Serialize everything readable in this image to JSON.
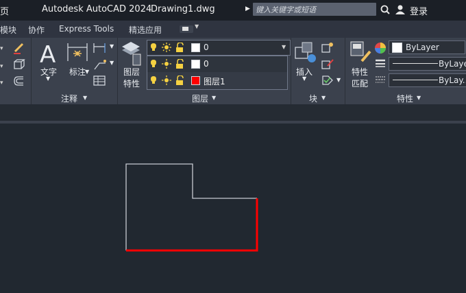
{
  "titlebar": {
    "app_title": "Autodesk AutoCAD 2024",
    "file_name": "Drawing1.dwg",
    "search_placeholder": "键入关键字或短语",
    "login": "登录",
    "left_cut": "页"
  },
  "tabs": [
    "模块",
    "协作",
    "Express Tools",
    "精选应用"
  ],
  "ribbon": {
    "annotate": {
      "text_label": "文字",
      "dim_label": "标注",
      "panel_label": "注释"
    },
    "layers": {
      "props_label_1": "图层",
      "props_label_2": "特性",
      "current_layer": "0",
      "rows": [
        {
          "name": "0",
          "color": "#ffffff"
        },
        {
          "name": "图层1",
          "color": "#ff0000"
        }
      ],
      "panel_label": "图层"
    },
    "block": {
      "insert_label": "插入",
      "panel_label": "块"
    },
    "properties": {
      "match_label_1": "特性",
      "match_label_2": "匹配",
      "color_value": "ByLayer",
      "linetype_value": "ByLayer",
      "lineweight_value": "ByLay...",
      "panel_label": "特性"
    }
  },
  "colors": {
    "accent_red": "#ff0000",
    "drawing_line": "#c8ccd2"
  }
}
